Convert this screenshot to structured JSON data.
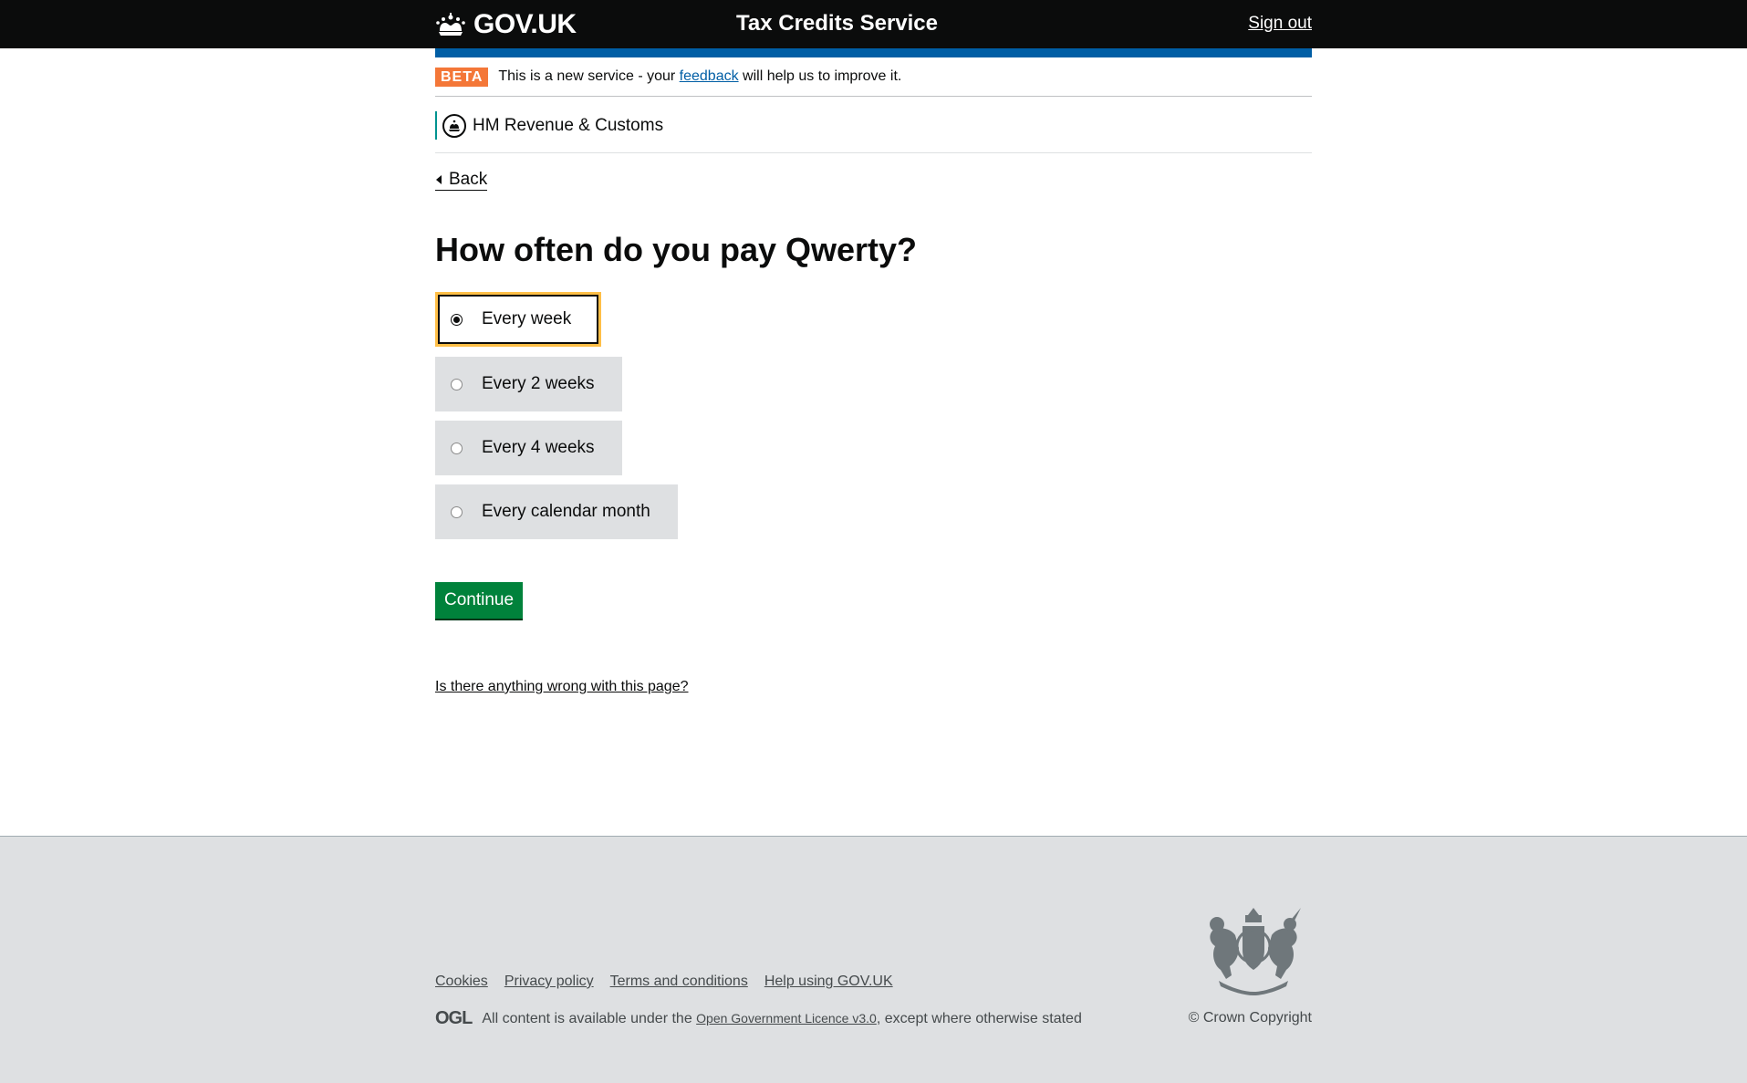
{
  "header": {
    "logo_text": "GOV.UK",
    "service_name": "Tax Credits Service",
    "sign_out": "Sign out"
  },
  "beta_banner": {
    "tag": "BETA",
    "text_before": "This is a new service - your ",
    "link": "feedback",
    "text_after": " will help us to improve it."
  },
  "organisation": {
    "name": "HM Revenue & Customs"
  },
  "back_link": "Back",
  "page_title": "How often do you pay Qwerty?",
  "options": [
    {
      "label": "Every week",
      "selected": true
    },
    {
      "label": "Every 2 weeks",
      "selected": false
    },
    {
      "label": "Every 4 weeks",
      "selected": false
    },
    {
      "label": "Every calendar month",
      "selected": false
    }
  ],
  "continue_button": "Continue",
  "report_link": "Is there anything wrong with this page?",
  "footer": {
    "links": [
      "Cookies",
      "Privacy policy",
      "Terms and conditions",
      "Help using GOV.UK"
    ],
    "ogl": "OGL",
    "licence_before": "All content is available under the ",
    "licence_link": "Open Government Licence v3.0",
    "licence_after": ", except where otherwise stated",
    "copyright": "© Crown Copyright"
  },
  "colors": {
    "header_bg": "#0b0c0c",
    "blue_bar": "#005ea5",
    "beta_tag": "#f47738",
    "button": "#00823b",
    "focus": "#ffbf47",
    "radio_bg": "#dee0e2",
    "footer_bg": "#dee0e2"
  }
}
